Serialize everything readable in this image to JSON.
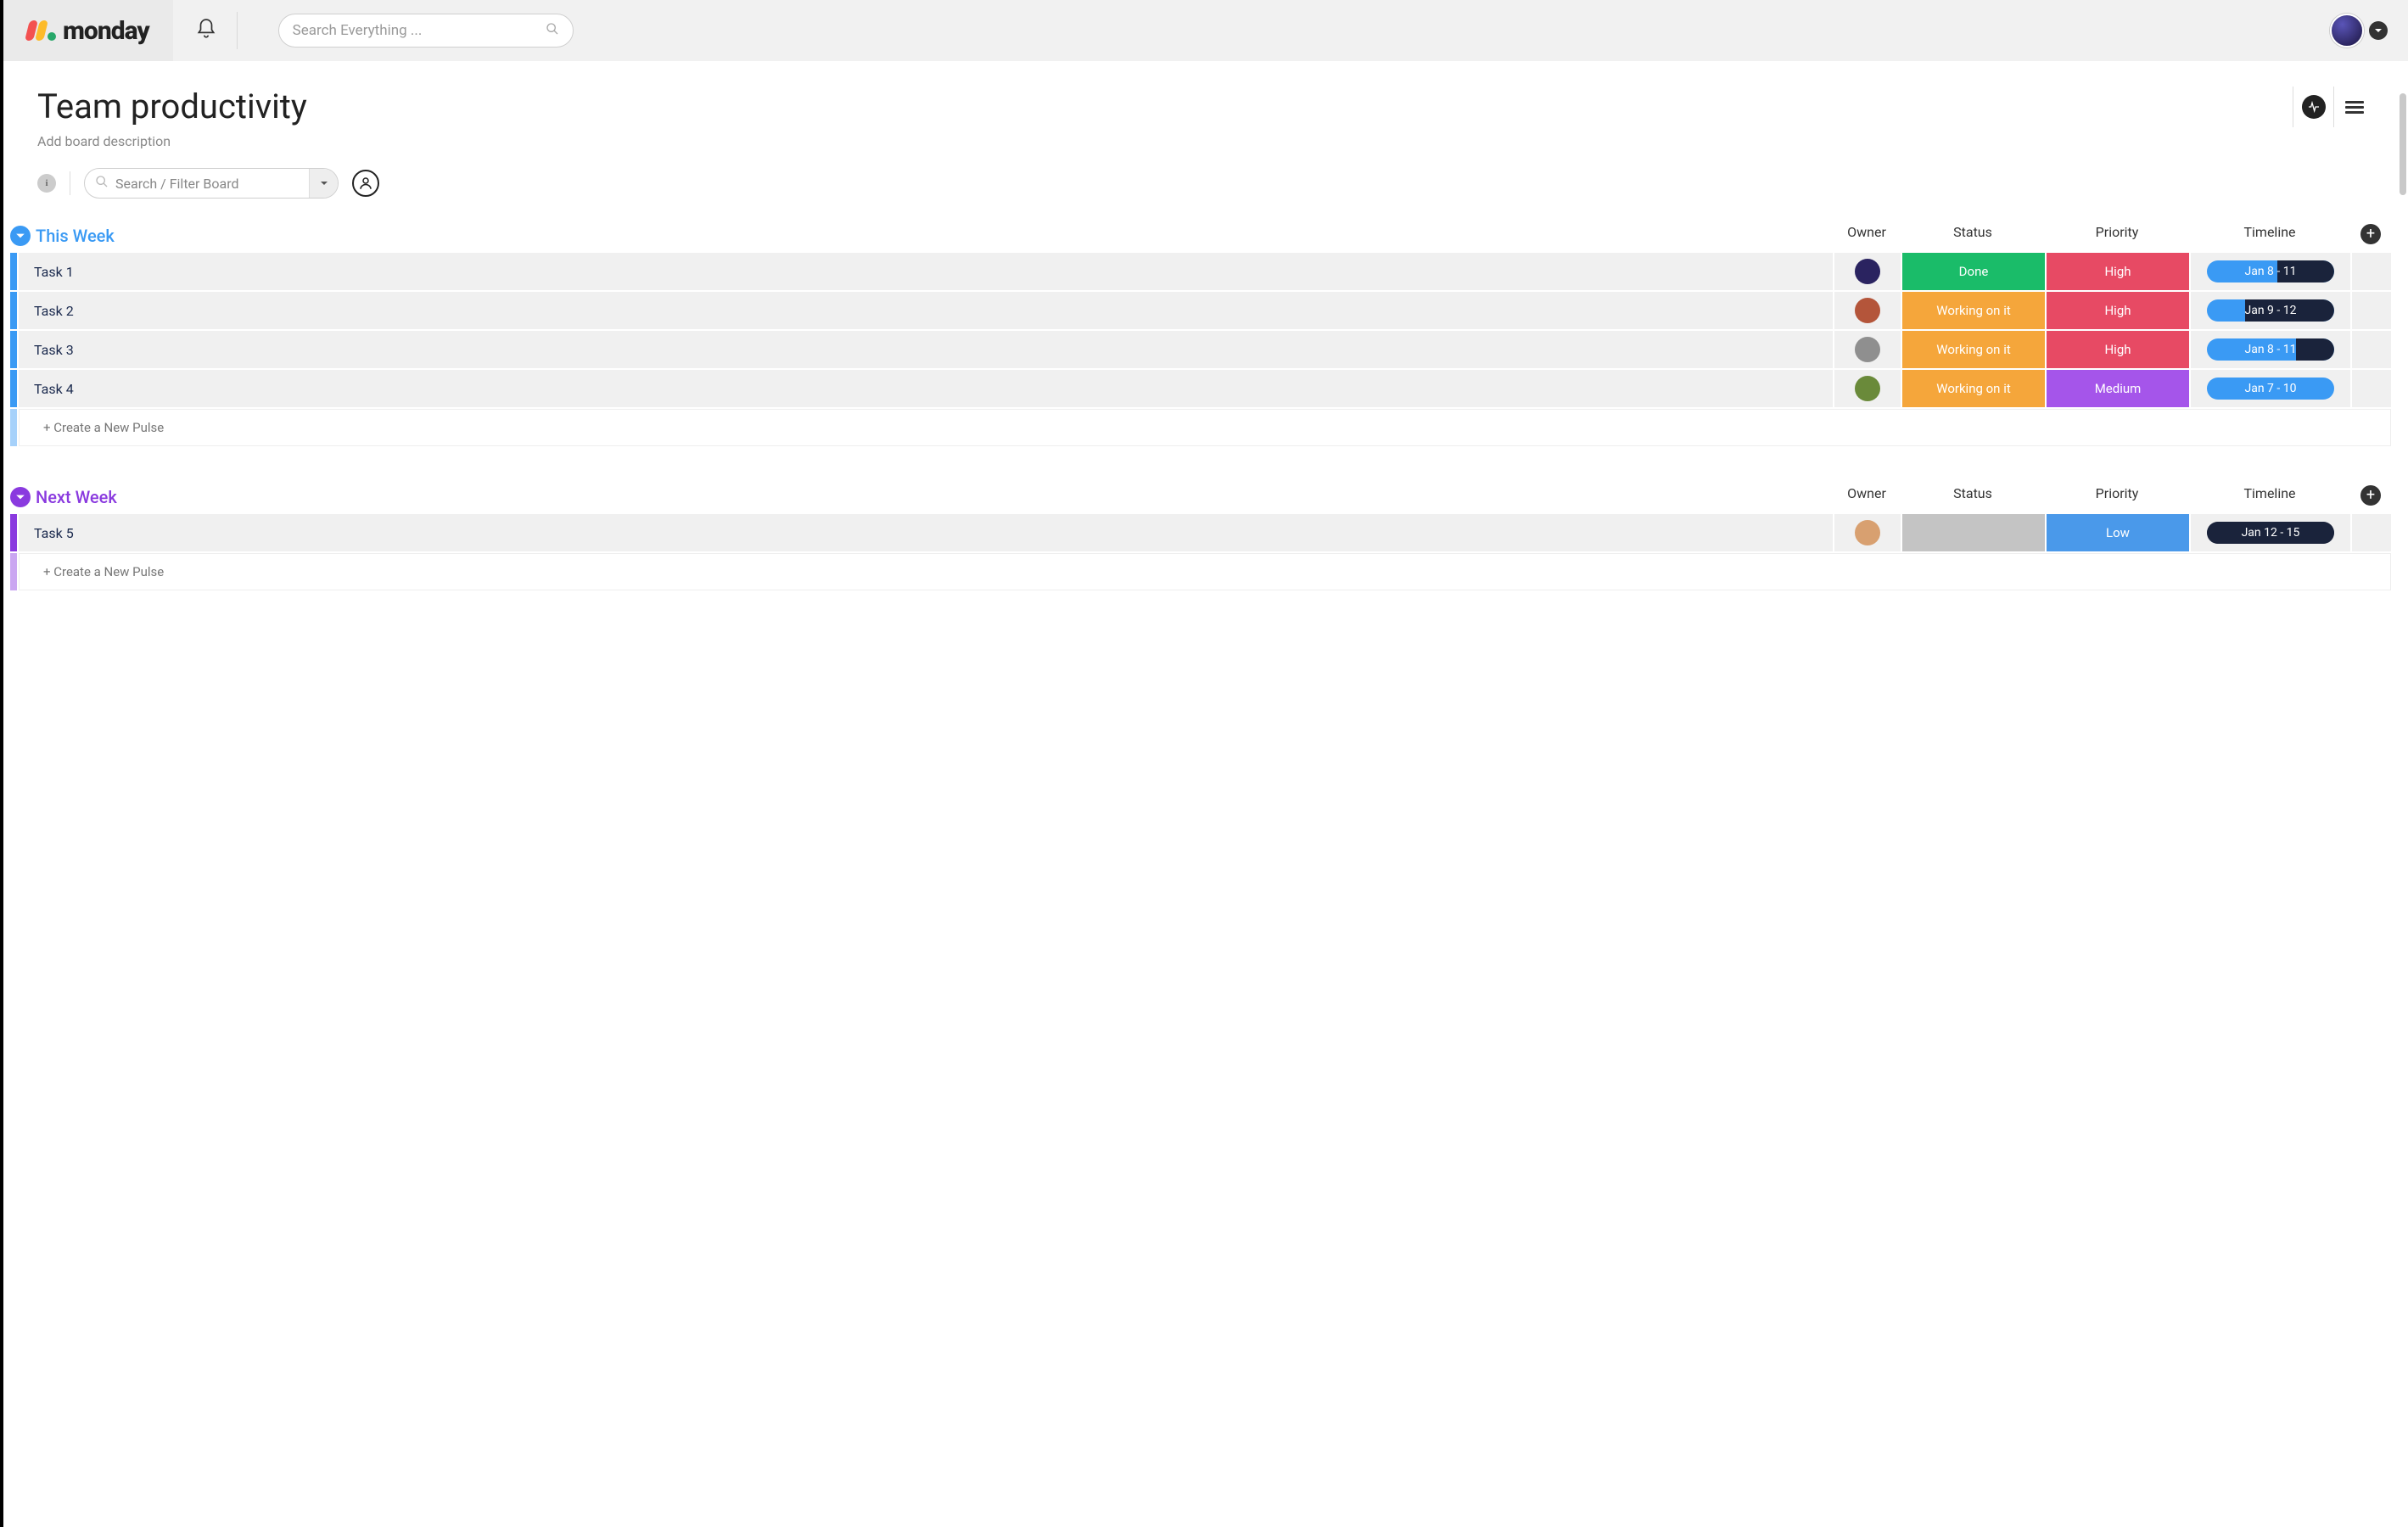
{
  "app": {
    "name": "monday"
  },
  "topbar": {
    "search_placeholder": "Search Everything ..."
  },
  "board": {
    "title": "Team productivity",
    "description_placeholder": "Add board description",
    "filter_placeholder": "Search / Filter Board",
    "info_glyph": "i"
  },
  "columns": {
    "owner": "Owner",
    "status": "Status",
    "priority": "Priority",
    "timeline": "Timeline"
  },
  "status_colors": {
    "Done": "#1abc69",
    "Working on it": "#f5a63b",
    "": "#c4c4c4"
  },
  "priority_colors": {
    "High": "#e74a64",
    "Medium": "#a555ea",
    "Low": "#4a99ea"
  },
  "groups": [
    {
      "id": "this-week",
      "title": "This Week",
      "color": "#3a9af4",
      "new_pulse_label": "+ Create a New Pulse",
      "rows": [
        {
          "name": "Task 1",
          "owner_color": "#2a2360",
          "status": "Done",
          "priority": "High",
          "timeline": "Jan 8 - 11",
          "timeline_fill_pct": 45,
          "timeline_base": "#3a9af4"
        },
        {
          "name": "Task 2",
          "owner_color": "#b4553a",
          "status": "Working on it",
          "priority": "High",
          "timeline": "Jan 9 - 12",
          "timeline_fill_pct": 70,
          "timeline_base": "#3a9af4"
        },
        {
          "name": "Task 3",
          "owner_color": "#8f8f8f",
          "status": "Working on it",
          "priority": "High",
          "timeline": "Jan 8 - 11",
          "timeline_fill_pct": 30,
          "timeline_base": "#3a9af4"
        },
        {
          "name": "Task 4",
          "owner_color": "#6a8a3a",
          "status": "Working on it",
          "priority": "Medium",
          "timeline": "Jan 7 - 10",
          "timeline_fill_pct": 0,
          "timeline_base": "#3a9af4"
        }
      ]
    },
    {
      "id": "next-week",
      "title": "Next Week",
      "color": "#8a3adf",
      "new_pulse_label": "+ Create a New Pulse",
      "rows": [
        {
          "name": "Task 5",
          "owner_color": "#d8a070",
          "status": "",
          "priority": "Low",
          "timeline": "Jan 12 - 15",
          "timeline_fill_pct": 100,
          "timeline_base": "#1a233b"
        }
      ]
    }
  ]
}
